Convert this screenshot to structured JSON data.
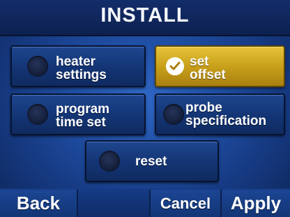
{
  "title": "INSTALL",
  "buttons": {
    "heater_settings": {
      "line1": "heater",
      "line2": "settings"
    },
    "set_offset": {
      "line1": "set",
      "line2": "offset",
      "selected": true
    },
    "program_time_set": {
      "line1": "program",
      "line2": "time set"
    },
    "probe_specification": {
      "line1": "probe",
      "line2": "specification"
    },
    "reset": {
      "label": "reset"
    }
  },
  "softkeys": {
    "back": "Back",
    "cancel": "Cancel",
    "apply": "Apply"
  },
  "colors": {
    "background": "#1f4ea3",
    "button": "#143676",
    "selected": "#c9a01a",
    "text": "#ffffff"
  },
  "icons": {
    "selected_indicator": "check-icon",
    "unselected_indicator": "led-indicator"
  }
}
